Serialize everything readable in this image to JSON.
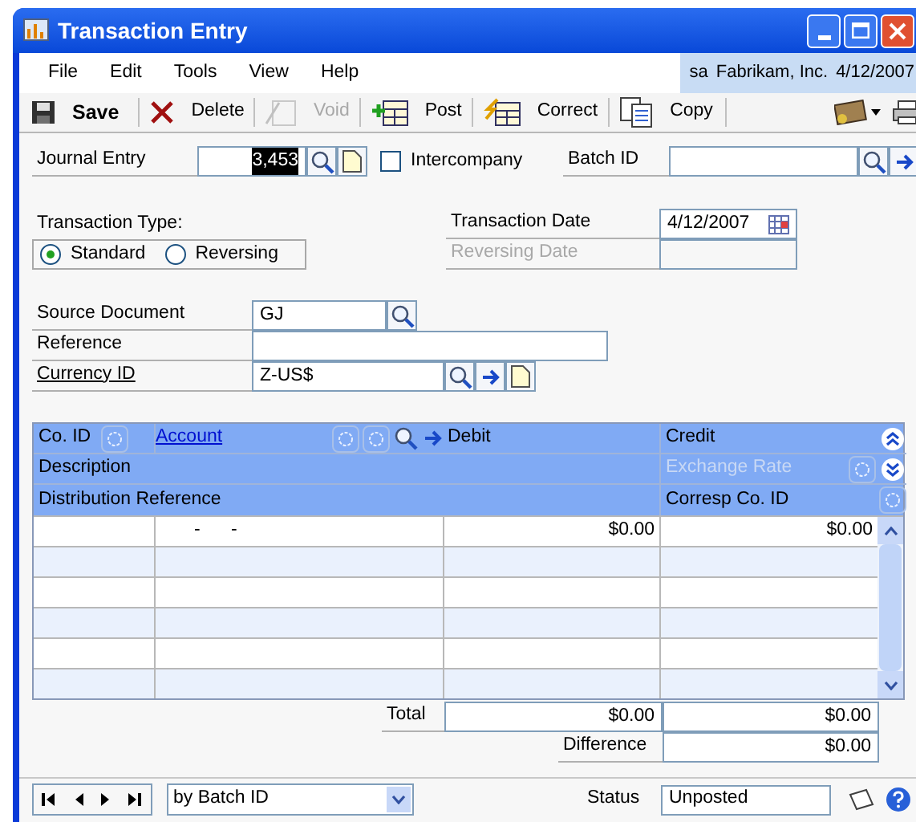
{
  "window": {
    "title": "Transaction Entry"
  },
  "menu": [
    {
      "label": "File"
    },
    {
      "label": "Edit"
    },
    {
      "label": "Tools"
    },
    {
      "label": "View"
    },
    {
      "label": "Help"
    }
  ],
  "session": {
    "user": "sa",
    "company": "Fabrikam, Inc.",
    "date": "4/12/2007"
  },
  "toolbar": [
    {
      "kind": "save",
      "label": "Save",
      "disabled": false
    },
    {
      "kind": "delete",
      "label": "Delete",
      "disabled": false
    },
    {
      "kind": "void",
      "label": "Void",
      "disabled": true
    },
    {
      "kind": "post",
      "label": "Post",
      "disabled": false
    },
    {
      "kind": "correct",
      "label": "Correct",
      "disabled": false
    },
    {
      "kind": "copy",
      "label": "Copy",
      "disabled": false
    }
  ],
  "form": {
    "journal_entry": {
      "label": "Journal Entry",
      "value": "3,453"
    },
    "intercompany": {
      "label": "Intercompany",
      "checked": false
    },
    "batch_id": {
      "label": "Batch ID"
    },
    "transaction_type": {
      "label": "Transaction Type:",
      "options": [
        {
          "label": "Standard",
          "selected": true
        },
        {
          "label": "Reversing",
          "selected": false
        }
      ]
    },
    "transaction_date": {
      "label": "Transaction Date",
      "value": "4/12/2007"
    },
    "reversing_date": {
      "label": "Reversing Date",
      "disabled": true
    },
    "source_document": {
      "label": "Source Document",
      "value": "GJ"
    },
    "reference": {
      "label": "Reference"
    },
    "currency_id": {
      "label": "Currency ID",
      "value": "Z-US$"
    }
  },
  "grid": {
    "headers": {
      "co_id": "Co. ID",
      "account": "Account",
      "debit": "Debit",
      "credit": "Credit",
      "description": "Description",
      "exchange_rate": {
        "label": "Exchange Rate",
        "disabled": true
      },
      "distribution_reference": "Distribution Reference",
      "corresp_co_id": "Corresp Co. ID"
    },
    "rows": [
      {
        "account": "-      -",
        "debit": "$0.00",
        "credit": "$0.00"
      }
    ]
  },
  "totals": {
    "label": "Total",
    "debit": "$0.00",
    "credit": "$0.00"
  },
  "difference": {
    "label": "Difference",
    "value": "$0.00"
  },
  "footer": {
    "browse_by": "by Batch ID",
    "status_label": "Status",
    "status": "Unposted"
  }
}
